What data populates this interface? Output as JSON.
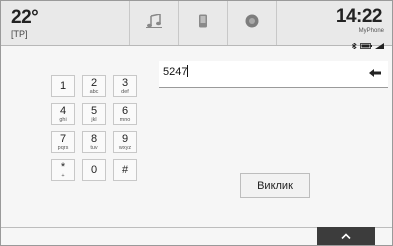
{
  "header": {
    "temperature": "22°",
    "station": "[TP]",
    "time": "14:22",
    "phone_name": "MyPhone"
  },
  "tabs": [
    {
      "icon": "music-note-icon"
    },
    {
      "icon": "phone-icon"
    },
    {
      "icon": "info-icon"
    }
  ],
  "keypad": {
    "keys": [
      {
        "digit": "1",
        "letters": ""
      },
      {
        "digit": "2",
        "letters": "abc"
      },
      {
        "digit": "3",
        "letters": "def"
      },
      {
        "digit": "4",
        "letters": "ghi"
      },
      {
        "digit": "5",
        "letters": "jkl"
      },
      {
        "digit": "6",
        "letters": "mno"
      },
      {
        "digit": "7",
        "letters": "pqrs"
      },
      {
        "digit": "8",
        "letters": "tuv"
      },
      {
        "digit": "9",
        "letters": "wxyz"
      },
      {
        "digit": "*",
        "letters": "+"
      },
      {
        "digit": "0",
        "letters": ""
      },
      {
        "digit": "#",
        "letters": ""
      }
    ]
  },
  "number_field": {
    "value": "5247"
  },
  "actions": {
    "call_label": "Виклик"
  }
}
